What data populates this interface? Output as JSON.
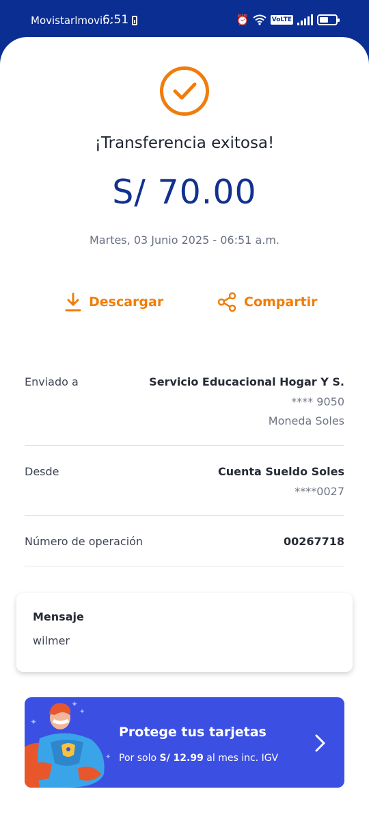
{
  "status_bar": {
    "carrier": "Movistarlmovi...",
    "time": "6:51",
    "volte": "VoLTE"
  },
  "receipt": {
    "title": "¡Transferencia exitosa!",
    "amount": "S/ 70.00",
    "date": "Martes, 03 Junio 2025 - 06:51 a.m."
  },
  "actions": {
    "download_label": "Descargar",
    "share_label": "Compartir"
  },
  "details": {
    "sent_to": {
      "label": "Enviado a",
      "name": "Servicio Educacional Hogar Y S.",
      "account": "**** 9050",
      "currency": "Moneda Soles"
    },
    "from": {
      "label": "Desde",
      "account_name": "Cuenta Sueldo Soles",
      "account": "****0027"
    },
    "operation": {
      "label": "Número de operación",
      "number": "00267718"
    }
  },
  "message": {
    "title": "Mensaje",
    "text": "wilmer"
  },
  "promo": {
    "title": "Protege tus tarjetas",
    "sub_prefix": "Por solo",
    "sub_price": "S/ 12.99",
    "sub_suffix": "al mes inc. IGV"
  },
  "colors": {
    "brand_blue": "#0b2e93",
    "amount_blue": "#12318f",
    "accent_orange": "#f07d0b",
    "promo_blue": "#3c4fe3"
  }
}
